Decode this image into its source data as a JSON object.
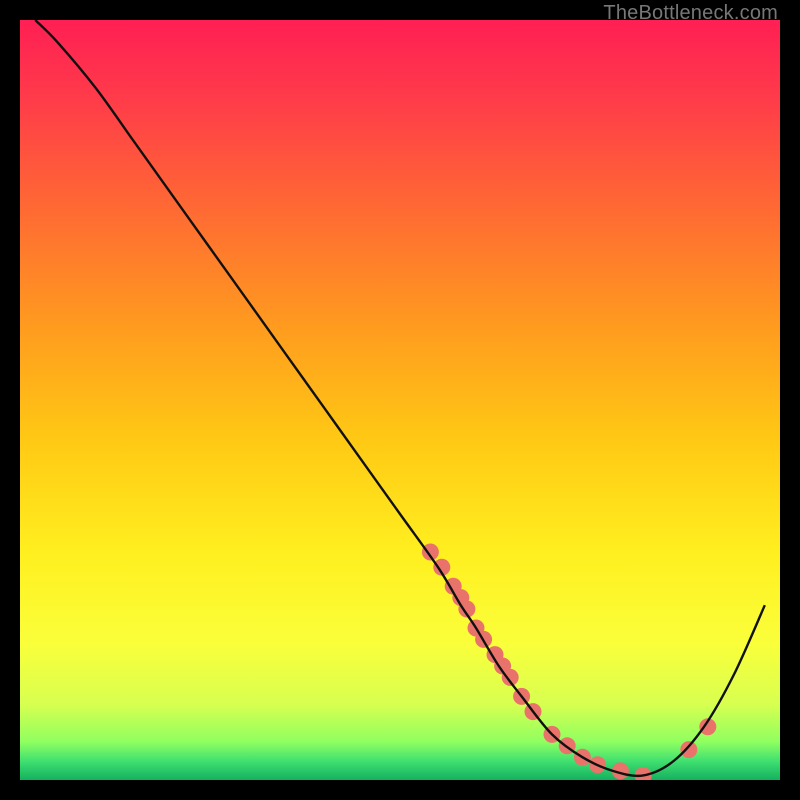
{
  "watermark": "TheBottleneck.com",
  "chart_data": {
    "type": "line",
    "title": "",
    "xlabel": "",
    "ylabel": "",
    "xlim": [
      0,
      100
    ],
    "ylim": [
      0,
      100
    ],
    "gradient_stops": [
      {
        "offset": 0.0,
        "color": "#ff1f54"
      },
      {
        "offset": 0.1,
        "color": "#ff3a4a"
      },
      {
        "offset": 0.25,
        "color": "#ff6a33"
      },
      {
        "offset": 0.4,
        "color": "#ff9a1f"
      },
      {
        "offset": 0.55,
        "color": "#ffc814"
      },
      {
        "offset": 0.7,
        "color": "#ffef1f"
      },
      {
        "offset": 0.82,
        "color": "#faff3a"
      },
      {
        "offset": 0.9,
        "color": "#d8ff50"
      },
      {
        "offset": 0.95,
        "color": "#8fff60"
      },
      {
        "offset": 0.975,
        "color": "#40e070"
      },
      {
        "offset": 1.0,
        "color": "#15b060"
      }
    ],
    "series": [
      {
        "name": "curve",
        "x": [
          2,
          5,
          10,
          15,
          20,
          25,
          30,
          35,
          40,
          45,
          50,
          55,
          58,
          60,
          63,
          66,
          70,
          74,
          78,
          82,
          86,
          90,
          94,
          98
        ],
        "y": [
          100,
          97,
          91,
          84,
          77,
          70,
          63,
          56,
          49,
          42,
          35,
          28,
          23,
          20,
          15,
          11,
          6,
          3,
          1.2,
          0.6,
          2.5,
          7,
          14,
          23
        ]
      }
    ],
    "points": {
      "name": "markers",
      "color": "#e9736b",
      "r": 8.5,
      "x": [
        54,
        55.5,
        57,
        58,
        58.8,
        60,
        61,
        62.5,
        63.5,
        64.5,
        66,
        67.5,
        70,
        72,
        74,
        76,
        79,
        82,
        88,
        90.5
      ],
      "y": [
        30,
        28,
        25.5,
        24,
        22.5,
        20,
        18.5,
        16.5,
        15,
        13.5,
        11,
        9,
        6,
        4.5,
        3,
        2,
        1.2,
        0.6,
        4,
        7
      ]
    }
  }
}
